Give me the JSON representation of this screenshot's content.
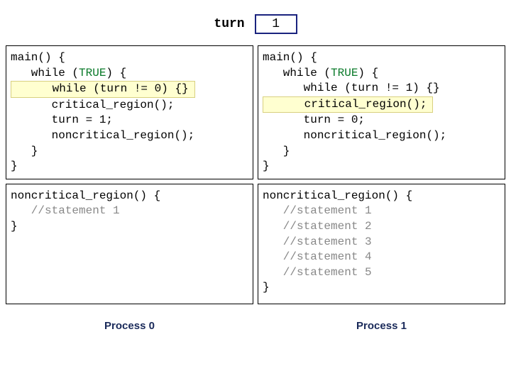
{
  "turn": {
    "label": "turn",
    "value": "1"
  },
  "left": {
    "main": {
      "l1": "main() {",
      "l2": "   while (",
      "l2_true": "TRUE",
      "l2_end": ") {",
      "hl": "      while (turn != 0) {}",
      "l4": "      critical_region();",
      "l5": "      turn = 1;",
      "l6": "      noncritical_region();",
      "l7": "   }",
      "l8": "}"
    },
    "nc": {
      "l1": "noncritical_region() {",
      "c1": "   //statement 1",
      "l3": "}"
    },
    "label": "Process 0"
  },
  "right": {
    "main": {
      "l1": "main() {",
      "l2": "   while (",
      "l2_true": "TRUE",
      "l2_end": ") {",
      "l3": "      while (turn != 1) {}",
      "hl": "      critical_region();",
      "l5": "      turn = 0;",
      "l6": "      noncritical_region();",
      "l7": "   }",
      "l8": "}"
    },
    "nc": {
      "l1": "noncritical_region() {",
      "c1": "   //statement 1",
      "c2": "   //statement 2",
      "c3": "   //statement 3",
      "c4": "   //statement 4",
      "c5": "   //statement 5",
      "l7": "}"
    },
    "label": "Process 1"
  }
}
